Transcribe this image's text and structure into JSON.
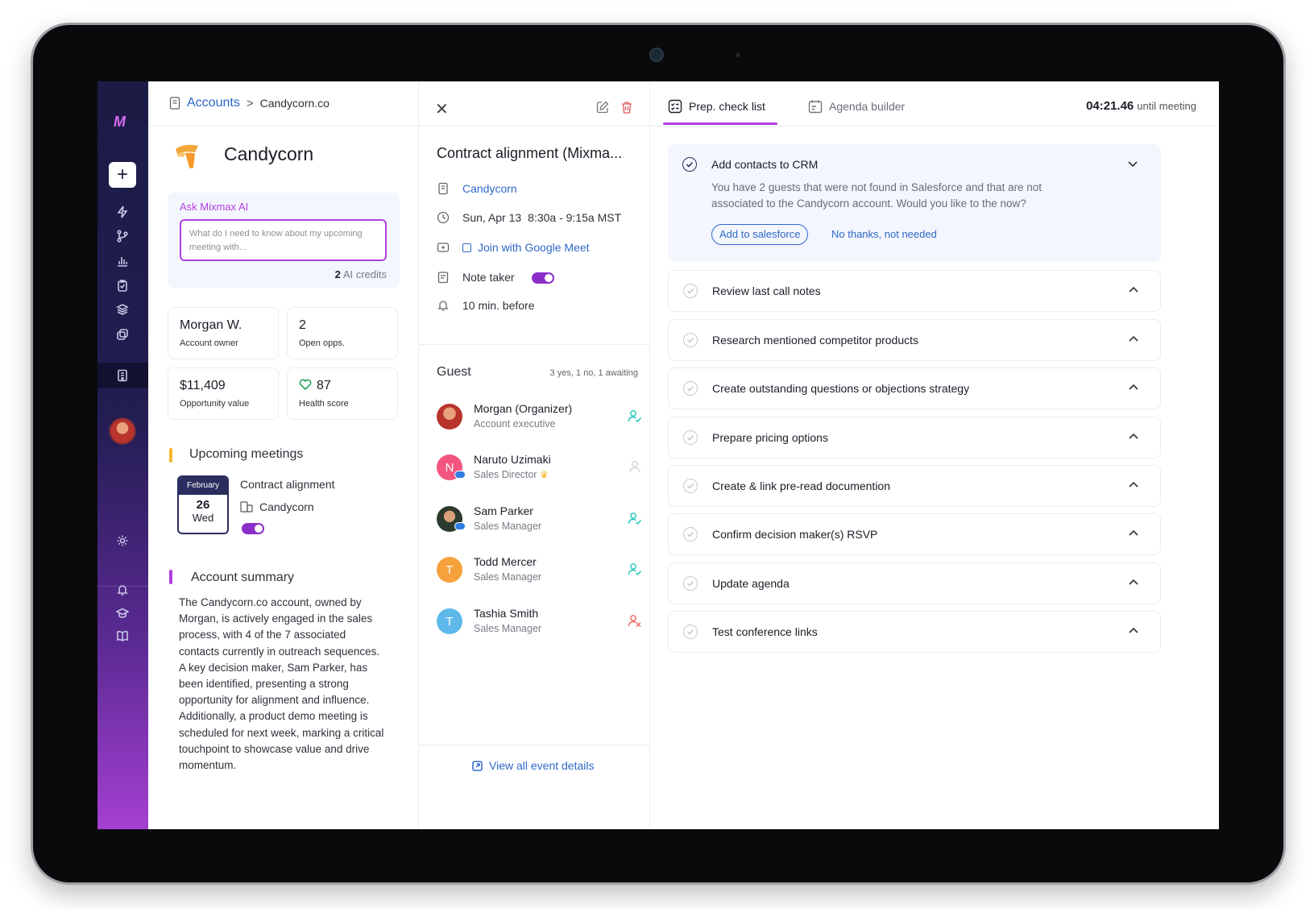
{
  "colors": {
    "accent": "#b23ee0",
    "link": "#2f68c9",
    "navy": "#2b2d5e"
  },
  "breadcrumb": {
    "parent": "Accounts",
    "separator": ">",
    "current": "Candycorn.co"
  },
  "account": {
    "name": "Candycorn"
  },
  "ai": {
    "label": "Ask Mixmax AI",
    "placeholder": "What do I need to know about my upcoming meeting with...",
    "credits_count": "2",
    "credits_label": "AI credits"
  },
  "stats": [
    {
      "value": "Morgan W.",
      "label": "Account owner"
    },
    {
      "value": "2",
      "label": "Open opps."
    },
    {
      "value": "$11,409",
      "label": "Opportunity value"
    },
    {
      "value": "87",
      "label": "Health score"
    }
  ],
  "upcoming": {
    "title": "Upcoming meetings",
    "month": "February",
    "day": "26",
    "weekday": "Wed",
    "meeting_title": "Contract alignment",
    "meeting_account": "Candycorn"
  },
  "summary": {
    "title": "Account summary",
    "text": "The Candycorn.co account, owned by Morgan, is actively engaged in the sales process, with 4 of the 7 associated contacts currently in outreach sequences. A key decision maker, Sam Parker, has been identified, presenting a strong opportunity for alignment and influence. Additionally, a product demo meeting is scheduled for next week, marking a critical touchpoint to showcase value and drive momentum."
  },
  "event": {
    "title": "Contract alignment (Mixma...",
    "account": "Candycorn",
    "date": "Sun, Apr 13",
    "time": "8:30a - 9:15a MST",
    "meet_link": "Join with Google Meet",
    "note_taker": "Note taker",
    "reminder": "10 min. before",
    "guest_title": "Guest",
    "guest_counts": "3 yes,  1 no,  1 awaiting",
    "view_all": "View all event details"
  },
  "guests": [
    {
      "name": "Morgan  (Organizer)",
      "role": "Account executive",
      "initial": "",
      "status": "yes"
    },
    {
      "name": "Naruto Uzimaki",
      "role": "Sales Director",
      "initial": "N",
      "status": "awaiting"
    },
    {
      "name": "Sam Parker",
      "role": "Sales Manager",
      "initial": "",
      "status": "yes"
    },
    {
      "name": "Todd Mercer",
      "role": "Sales Manager",
      "initial": "T",
      "status": "yes"
    },
    {
      "name": "Tashia Smith",
      "role": "Sales Manager",
      "initial": "T",
      "status": "no"
    }
  ],
  "tabs": [
    {
      "label": "Prep. check list",
      "active": true
    },
    {
      "label": "Agenda builder",
      "active": false
    }
  ],
  "timer": {
    "value": "04:21.46",
    "suffix": "until meeting"
  },
  "checklist_expanded": {
    "title": "Add contacts to CRM",
    "description": "You have 2 guests that were not found in Salesforce and that are not associated to the Candycorn account. Would you like to the now?",
    "primary": "Add to salesforce",
    "secondary": "No thanks, not needed"
  },
  "checklist": [
    "Review last call notes",
    "Research mentioned competitor products",
    "Create outstanding questions or objections strategy",
    "Prepare pricing options",
    "Create & link pre-read documention",
    "Confirm decision maker(s) RSVP",
    "Update agenda",
    "Test conference links"
  ]
}
